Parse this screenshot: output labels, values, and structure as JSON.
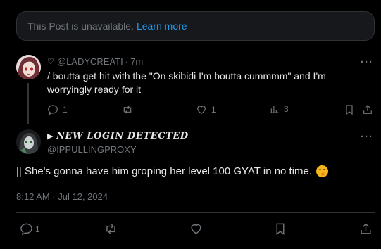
{
  "unavailable": {
    "text": "This Post is unavailable.",
    "link": "Learn more"
  },
  "reply": {
    "handle": "@LADYCREATI",
    "separator": "·",
    "time": "7m",
    "text": "/ boutta get hit with the \"On skibidi I'm boutta cummmm\" and I'm worryingly ready for it",
    "more": "···",
    "actions": {
      "replies": "1",
      "likes": "1",
      "views": "3"
    }
  },
  "main": {
    "display_name": "NEW LOGIN DETECTED",
    "handle": "@IPPULLINGPROXY",
    "text": "|| She's gonna have him groping her level 100 GYAT in no time.",
    "emoji": "face-with-hand-over-mouth",
    "timestamp": "8:12 AM · Jul 12, 2024",
    "more": "···",
    "actions": {
      "replies": "1"
    }
  },
  "colors": {
    "link": "#1d9bf0",
    "muted": "#71767b",
    "text": "#e7e9ea",
    "border": "#2f3336"
  }
}
